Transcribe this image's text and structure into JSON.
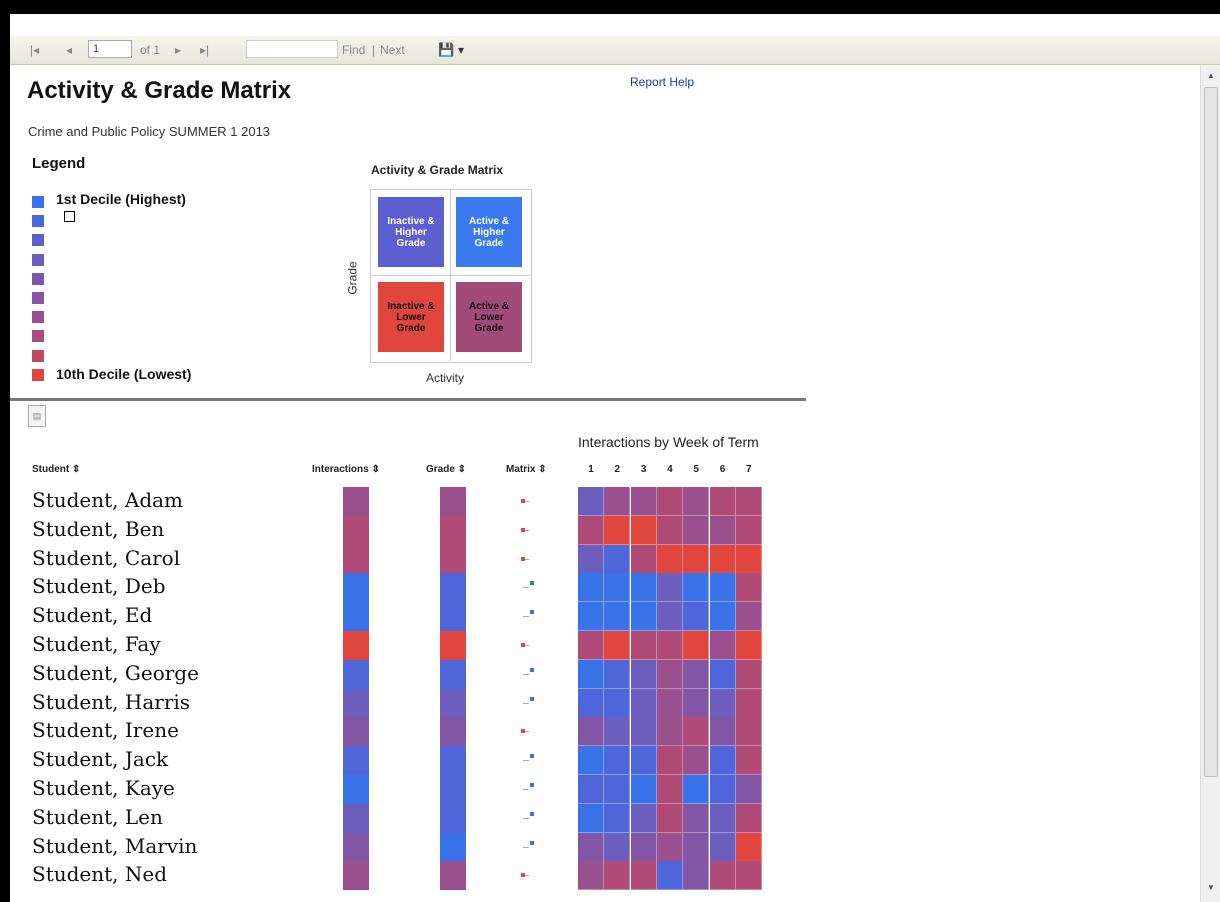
{
  "toolbar": {
    "first_glyph": "|◂",
    "prev_glyph": "◂",
    "page_value": "1",
    "of_label": "of 1",
    "next_glyph": "▸",
    "last_glyph": "▸|",
    "find_label": "Find",
    "find_sep": "|",
    "next_label": "Next",
    "export_glyph": "💾",
    "export_arrow": "▾"
  },
  "report": {
    "title": "Activity & Grade Matrix",
    "help_link": "Report Help",
    "subtitle": "Crime and Public Policy SUMMER 1 2013"
  },
  "legend": {
    "title": "Legend",
    "high_label": "1st Decile (Highest)",
    "low_label": "10th Decile (Lowest)",
    "colors": [
      "#3a72ea",
      "#4b67dc",
      "#5d60cc",
      "#6b5ebd",
      "#7a59ae",
      "#8a55a0",
      "#995092",
      "#a94b82",
      "#c2485f",
      "#e0463e"
    ]
  },
  "matrix": {
    "title": "Activity & Grade Matrix",
    "y_label": "Grade",
    "x_label": "Activity",
    "q_tl": [
      "Inactive &",
      "Higher",
      "Grade"
    ],
    "q_tr": [
      "Active &",
      "Higher",
      "Grade"
    ],
    "q_bl": [
      "Inactive &",
      "Lower",
      "Grade"
    ],
    "q_br": [
      "Active &",
      "Lower",
      "Grade"
    ],
    "q_colors": {
      "tl": "#5b5fd0",
      "tr": "#3a78ee",
      "bl": "#e0463e",
      "br": "#a24a7a"
    }
  },
  "table": {
    "week_title": "Interactions by Week of Term",
    "col_student": "Student ⇕",
    "col_interactions": "Interactions ⇕",
    "col_grade": "Grade ⇕",
    "col_matrix": "Matrix ⇕",
    "weeks": [
      "1",
      "2",
      "3",
      "4",
      "5",
      "6",
      "7"
    ],
    "palette": {
      "b": "#3a72ea",
      "B": "#4f66da",
      "p": "#6b5ebd",
      "P": "#8356a5",
      "m": "#9a4f8e",
      "M": "#b04a77",
      "r": "#cf4750",
      "R": "#e0463e"
    },
    "matrix_colors": {
      "r": "#e0463e",
      "b": "#3a72ea"
    },
    "students": [
      {
        "name": "Student, Adam",
        "interactions": "m",
        "grade": "m",
        "matrix": "r",
        "weeks": [
          "p",
          "m",
          "m",
          "M",
          "m",
          "M",
          "M"
        ]
      },
      {
        "name": "Student, Ben",
        "interactions": "M",
        "grade": "M",
        "matrix": "r",
        "weeks": [
          "M",
          "R",
          "R",
          "M",
          "m",
          "m",
          "M"
        ]
      },
      {
        "name": "Student, Carol",
        "interactions": "M",
        "grade": "M",
        "matrix": "r",
        "weeks": [
          "p",
          "B",
          "M",
          "R",
          "R",
          "R",
          "R"
        ]
      },
      {
        "name": "Student, Deb",
        "interactions": "b",
        "grade": "B",
        "matrix": "b",
        "weeks": [
          "b",
          "b",
          "b",
          "p",
          "b",
          "b",
          "M"
        ]
      },
      {
        "name": "Student, Ed",
        "interactions": "b",
        "grade": "B",
        "matrix": "b",
        "weeks": [
          "b",
          "b",
          "b",
          "p",
          "B",
          "b",
          "m"
        ]
      },
      {
        "name": "Student, Fay",
        "interactions": "R",
        "grade": "R",
        "matrix": "r",
        "weeks": [
          "M",
          "R",
          "M",
          "M",
          "R",
          "m",
          "R"
        ]
      },
      {
        "name": "Student, George",
        "interactions": "B",
        "grade": "B",
        "matrix": "b",
        "weeks": [
          "b",
          "B",
          "p",
          "m",
          "P",
          "B",
          "M"
        ]
      },
      {
        "name": "Student, Harris",
        "interactions": "p",
        "grade": "p",
        "matrix": "b",
        "weeks": [
          "B",
          "B",
          "p",
          "m",
          "P",
          "p",
          "M"
        ]
      },
      {
        "name": "Student, Irene",
        "interactions": "P",
        "grade": "P",
        "matrix": "r",
        "weeks": [
          "P",
          "p",
          "p",
          "m",
          "M",
          "P",
          "M"
        ]
      },
      {
        "name": "Student, Jack",
        "interactions": "B",
        "grade": "B",
        "matrix": "b",
        "weeks": [
          "b",
          "B",
          "B",
          "M",
          "m",
          "B",
          "M"
        ]
      },
      {
        "name": "Student, Kaye",
        "interactions": "b",
        "grade": "B",
        "matrix": "b",
        "weeks": [
          "B",
          "B",
          "b",
          "M",
          "b",
          "B",
          "P"
        ]
      },
      {
        "name": "Student, Len",
        "interactions": "p",
        "grade": "B",
        "matrix": "b",
        "weeks": [
          "b",
          "B",
          "p",
          "M",
          "P",
          "p",
          "M"
        ]
      },
      {
        "name": "Student, Marvin",
        "interactions": "P",
        "grade": "b",
        "matrix": "b",
        "weeks": [
          "P",
          "p",
          "P",
          "m",
          "P",
          "p",
          "R"
        ]
      },
      {
        "name": "Student, Ned",
        "interactions": "m",
        "grade": "m",
        "matrix": "r",
        "weeks": [
          "m",
          "M",
          "M",
          "B",
          "P",
          "M",
          "M"
        ]
      }
    ]
  }
}
